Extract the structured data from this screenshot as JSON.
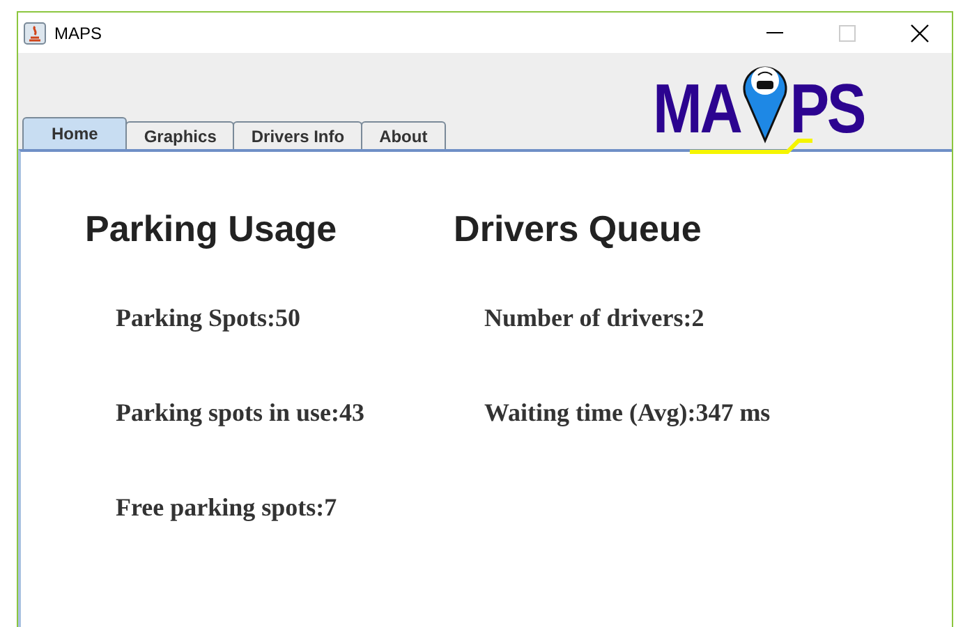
{
  "window": {
    "title": "MAPS"
  },
  "logo": {
    "left": "MA",
    "right": "PS"
  },
  "tabs": [
    {
      "label": "Home",
      "selected": true
    },
    {
      "label": "Graphics",
      "selected": false
    },
    {
      "label": "Drivers Info",
      "selected": false
    },
    {
      "label": "About",
      "selected": false
    }
  ],
  "sections": [
    {
      "title": "Parking Usage",
      "stats": [
        {
          "label": "Parking Spots:",
          "value": "50"
        },
        {
          "label": "Parking spots in use:",
          "value": "43"
        },
        {
          "label": "Free parking spots:",
          "value": "7"
        }
      ]
    },
    {
      "title": "Drivers Queue",
      "stats": [
        {
          "label": "Number of drivers:",
          "value": "2"
        },
        {
          "label": "Waiting time (Avg):",
          "value": "347 ms"
        }
      ]
    }
  ]
}
